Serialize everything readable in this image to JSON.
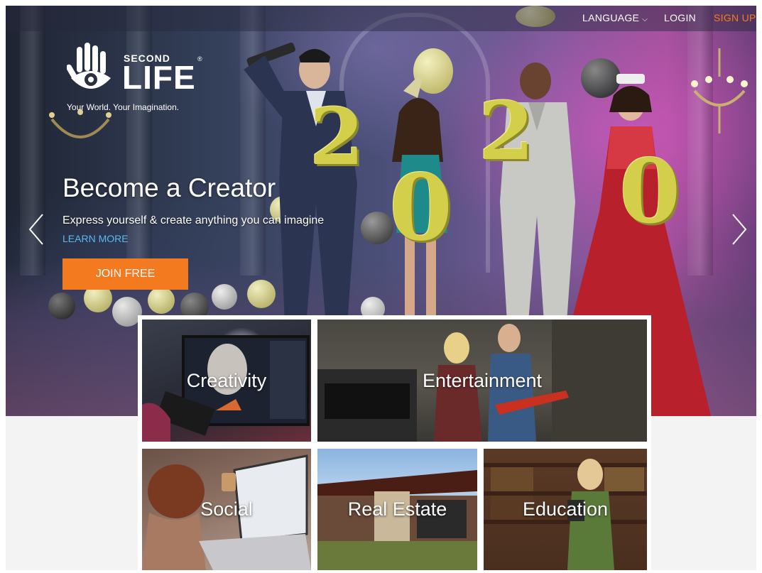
{
  "nav": {
    "language_label": "LANGUAGE",
    "login_label": "LOGIN",
    "signup_label": "SIGN UP"
  },
  "logo": {
    "wordmark_top": "SECOND",
    "wordmark_main": "LIFE",
    "registered": "®",
    "tagline": "Your World. Your Imagination."
  },
  "hero": {
    "title": "Become a Creator",
    "subtitle": "Express yourself & create anything you can imagine",
    "learn_more": "LEARN MORE",
    "cta": "JOIN FREE",
    "year_digits": [
      "2",
      "0",
      "2",
      "0"
    ]
  },
  "tiles": [
    {
      "label": "Creativity"
    },
    {
      "label": "Entertainment"
    },
    {
      "label": "Social"
    },
    {
      "label": "Real Estate"
    },
    {
      "label": "Education"
    }
  ],
  "colors": {
    "accent": "#f47a20",
    "link": "#5bb8f0",
    "page_bg": "#f3f3f3"
  },
  "icons": {
    "prev": "chevron-left-icon",
    "next": "chevron-right-icon",
    "language_dropdown": "chevron-down-icon",
    "logo": "hand-eye-logo-icon"
  }
}
